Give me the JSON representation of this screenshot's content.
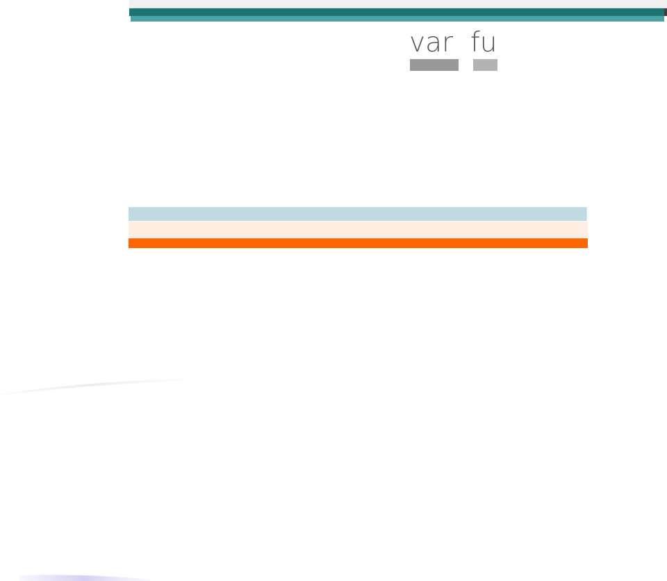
{
  "tags": {
    "first": "var",
    "second": "fu"
  },
  "colors": {
    "top_strip": "#f0f0f0",
    "header_dark": "#1d7372",
    "header_light": "#4ba3a3",
    "header_edge": "#3e3e3e",
    "tag_text": "#555555",
    "tag_underline_first": "#999999",
    "tag_underline_second": "#b3b3b3",
    "band_blue": "#bfdbe1",
    "band_peach": "#ffeee4",
    "band_orange": "#ff6600",
    "background": "#ffffff"
  }
}
